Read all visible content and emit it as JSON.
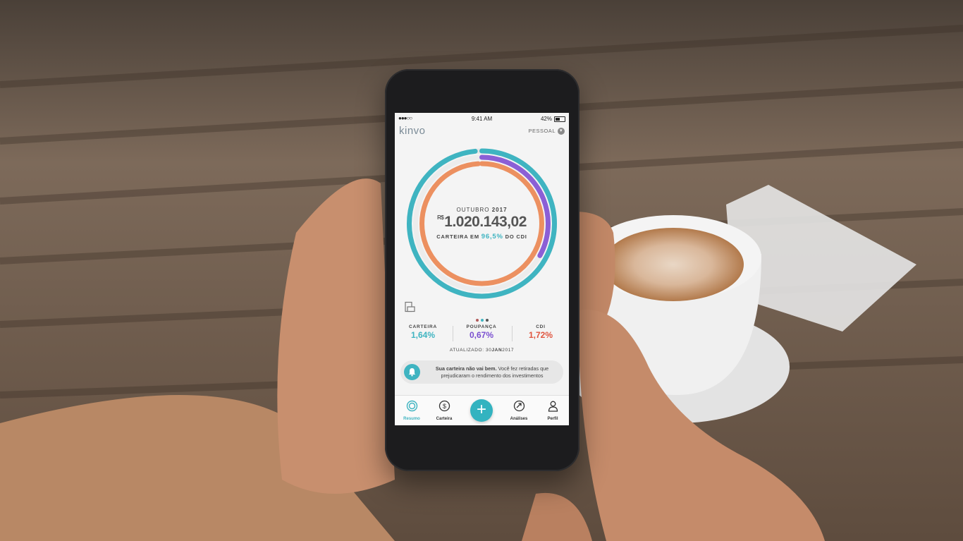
{
  "status": {
    "carrier": "●●●○○",
    "time": "9:41 AM",
    "battery": "42%"
  },
  "app": {
    "logo": "kinvo",
    "profile": "PESSOAL"
  },
  "summary": {
    "month": "OUTUBRO",
    "year": "2017",
    "currency": "R$",
    "amount": "1.020.143,02",
    "cdi_prefix": "CARTEIRA EM",
    "cdi_pct": "96,5%",
    "cdi_suffix": "DO CDI"
  },
  "stats": [
    {
      "label": "CARTEIRA",
      "value": "1,64%",
      "color": "#3fb4c1"
    },
    {
      "label": "POUPANÇA",
      "value": "0,67%",
      "color": "#7a4fd0"
    },
    {
      "label": "CDI",
      "value": "1,72%",
      "color": "#e0553f"
    }
  ],
  "updated": {
    "label": "ATUALIZADO:",
    "day": "30",
    "month": "JAN",
    "year": "2017"
  },
  "alert": {
    "title": "Sua carteira não vai bem.",
    "text": "Você fez retiradas que prejudicaram o rendimento dos investimentos"
  },
  "tabs": [
    {
      "label": "Resumo",
      "icon": "summary-icon",
      "active": true
    },
    {
      "label": "Carteira",
      "icon": "dollar-icon"
    },
    {
      "label": "Análises",
      "icon": "trend-icon"
    },
    {
      "label": "Perfil",
      "icon": "user-icon"
    }
  ],
  "rings": {
    "carteira": {
      "color": "#3fb4c1",
      "fraction": 0.985
    },
    "poupanca": {
      "color": "#8b5fd6",
      "fraction": 0.33
    },
    "cdi": {
      "color": "#ec9060",
      "fraction": 0.99
    }
  }
}
